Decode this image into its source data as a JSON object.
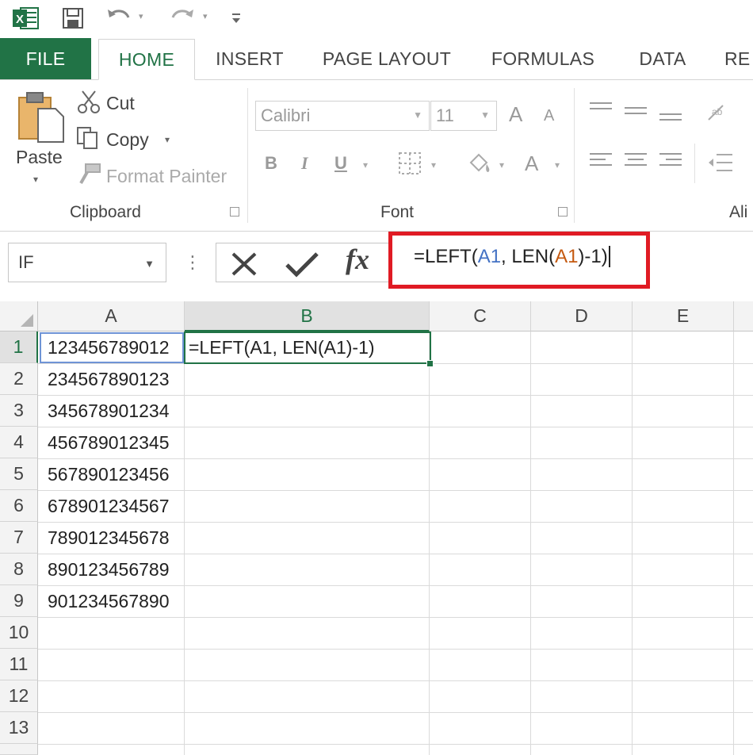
{
  "qat": {
    "logo_text": "X",
    "icons": [
      "excel-logo-icon",
      "save-icon",
      "undo-icon",
      "redo-icon",
      "customize-qat-icon"
    ]
  },
  "tabs": [
    {
      "label": "FILE"
    },
    {
      "label": "HOME"
    },
    {
      "label": "INSERT"
    },
    {
      "label": "PAGE LAYOUT"
    },
    {
      "label": "FORMULAS"
    },
    {
      "label": "DATA"
    },
    {
      "label": "RE"
    }
  ],
  "ribbon": {
    "clipboard": {
      "paste_label": "Paste",
      "cut_label": "Cut",
      "copy_label": "Copy",
      "format_painter_label": "Format Painter",
      "group_label": "Clipboard"
    },
    "font": {
      "font_name": "Calibri",
      "font_size": "11",
      "bold": "B",
      "italic": "I",
      "underline": "U",
      "grow": "A",
      "shrink": "A",
      "font_color": "A",
      "group_label": "Font"
    },
    "alignment": {
      "group_label": "Ali"
    }
  },
  "formula_bar": {
    "name_box": "IF",
    "formula_prefix": "=LEFT(",
    "ref_a": "A1",
    "formula_mid": ", LEN(",
    "ref_b": "A1",
    "formula_suffix": ")-1)"
  },
  "grid": {
    "columns": [
      "A",
      "B",
      "C",
      "D",
      "E"
    ],
    "rows": [
      "1",
      "2",
      "3",
      "4",
      "5",
      "6",
      "7",
      "8",
      "9",
      "10",
      "11",
      "12",
      "13"
    ],
    "col_a_values": [
      "123456789012",
      "234567890123",
      "345678901234",
      "456789012345",
      "567890123456",
      "678901234567",
      "789012345678",
      "890123456789",
      "901234567890"
    ],
    "b1_value": "=LEFT(A1, LEN(A1)-1)"
  },
  "colors": {
    "excel_green": "#217346",
    "highlight_red": "#e01b24",
    "ref_blue": "#4472c4",
    "ref_orange": "#c55a11"
  }
}
